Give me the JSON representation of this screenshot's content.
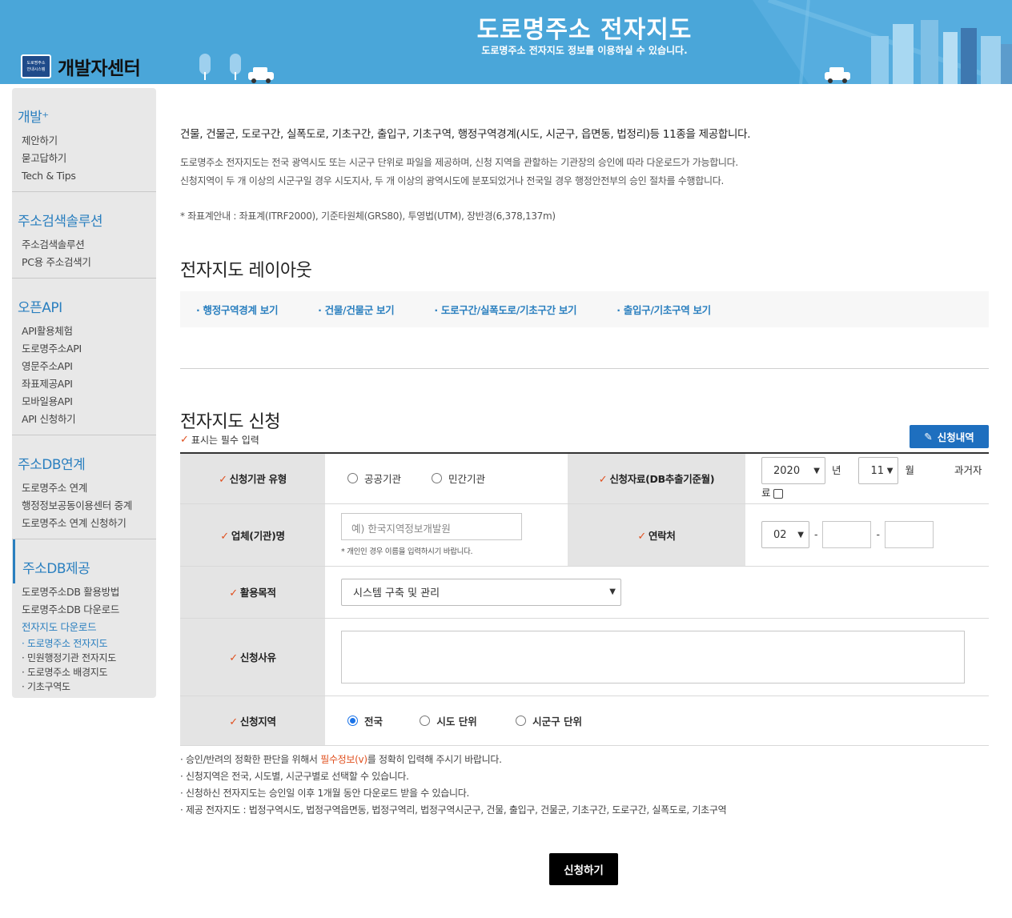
{
  "header": {
    "logo_line1": "도로명주소",
    "logo_line2": "안내시스템",
    "logo_title": "개발자센터",
    "hero_title": "도로명주소 전자지도",
    "hero_subtitle": "도로명주소 전자지도 정보를 이용하실 수 있습니다."
  },
  "sidebar": {
    "groups": [
      {
        "title": "개발⁺",
        "items": [
          "제안하기",
          "묻고답하기",
          "Tech & Tips"
        ]
      },
      {
        "title": "주소검색솔루션",
        "items": [
          "주소검색솔루션",
          "PC용 주소검색기"
        ]
      },
      {
        "title": "오픈API",
        "items": [
          "API활용체험",
          "도로명주소API",
          "영문주소API",
          "좌표제공API",
          "모바일용API",
          "API 신청하기"
        ]
      },
      {
        "title": "주소DB연계",
        "items": [
          "도로명주소 연계",
          "행정정보공동이용센터 중계",
          "도로명주소 연계 신청하기"
        ]
      },
      {
        "title": "주소DB제공",
        "items": [
          "도로명주소DB 활용방법",
          "도로명주소DB 다운로드",
          "전자지도 다운로드"
        ],
        "subitems": [
          "· 도로명주소 전자지도",
          "· 민원행정기관 전자지도",
          "· 도로명주소 배경지도",
          "· 기초구역도"
        ]
      }
    ]
  },
  "main": {
    "lead": "건물, 건물군, 도로구간, 실폭도로, 기초구간, 출입구, 기초구역, 행정구역경계(시도, 시군구, 읍면동, 법정리)등 11종을 제공합니다.",
    "desc1": "도로명주소 전자지도는 전국 광역시도 또는 시군구 단위로 파일을 제공하며, 신청 지역을 관할하는 기관장의 승인에 따라 다운로드가 가능합니다.",
    "desc2": "신청지역이 두 개 이상의 시군구일 경우 시도지사, 두 개 이상의 광역시도에 분포되었거나 전국일 경우 행정안전부의 승인 절차를 수행합니다.",
    "coord": "* 좌표계안내 : 좌표계(ITRF2000), 기준타원체(GRS80), 투영법(UTM), 장반경(6,378,137m)",
    "layout_title": "전자지도 레이아웃",
    "layout_links": [
      "· 행정구역경계 보기",
      "· 건물/건물군 보기",
      "· 도로구간/실폭도로/기초구간 보기",
      "· 출입구/기초구역 보기"
    ],
    "apply_title": "전자지도 신청",
    "required_mark": "✓",
    "required_note": "표시는 필수 입력",
    "history_button": "신청내역"
  },
  "form": {
    "org_type_label": "신청기관 유형",
    "org_type_options": [
      "공공기관",
      "민간기관"
    ],
    "data_label": "신청자료(DB추출기준월)",
    "year": "2020",
    "year_unit": "년",
    "month": "11",
    "month_unit": "월",
    "past_label": "과거자료",
    "company_label": "업체(기관)명",
    "company_placeholder": "예) 한국지역정보개발원",
    "company_note": "* 개인인 경우 이름을 입력하시기 바랍니다.",
    "contact_label": "연락처",
    "phone_prefix": "02",
    "dash": "-",
    "purpose_label": "활용목적",
    "purpose_value": "시스템 구축 및 관리",
    "reason_label": "신청사유",
    "region_label": "신청지역",
    "region_options": [
      "전국",
      "시도 단위",
      "시군구 단위"
    ],
    "region_selected": "전국"
  },
  "notes": {
    "n1_pre": "· 승인/반려의 정확한 판단을 위해서 ",
    "n1_red": "필수정보(v)",
    "n1_post": "를 정확히 입력해 주시기 바랍니다.",
    "n2": "· 신청지역은 전국, 시도별, 시군구별로 선택할 수 있습니다.",
    "n3": "· 신청하신 전자지도는 승인일 이후 1개월 동안 다운로드 받을 수 있습니다.",
    "n4": "· 제공 전자지도 : 법정구역시도, 법정구역읍면동, 법정구역리, 법정구역시군구, 건물, 출입구, 건물군, 기초구간, 도로구간, 실폭도로, 기초구역"
  },
  "submit_label": "신청하기",
  "colors": {
    "header_bg": "#4aa6d9",
    "accent": "#2a7fbf",
    "check": "#e0501f",
    "button_blue": "#1e6fbf"
  }
}
